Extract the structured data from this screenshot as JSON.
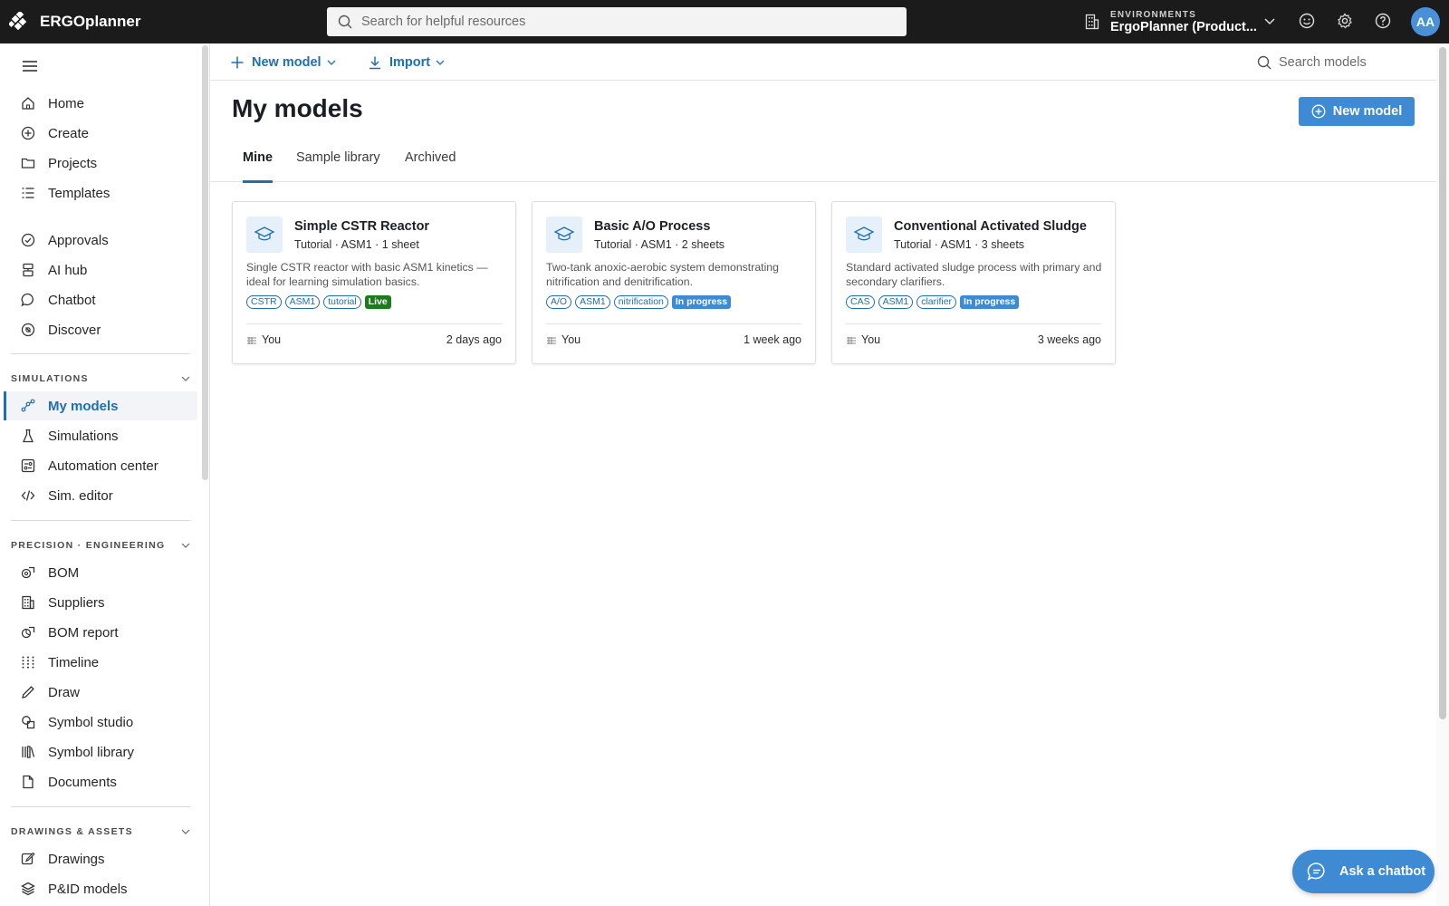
{
  "app": {
    "title": "ERGOplanner"
  },
  "search": {
    "placeholder": "Search for helpful resources"
  },
  "environment": {
    "label": "ENVIRONMENTS",
    "value": "ErgoPlanner (Product..."
  },
  "user": {
    "initials": "AA"
  },
  "sidebar": {
    "items": [
      {
        "label": "Home",
        "icon": "home-icon"
      },
      {
        "label": "Create",
        "icon": "plus-circle-icon"
      },
      {
        "label": "Projects",
        "icon": "folder-icon"
      },
      {
        "label": "Templates",
        "icon": "list-icon"
      },
      {
        "label": "Approvals",
        "icon": "check-circle-icon"
      },
      {
        "label": "AI hub",
        "icon": "ai-hub-icon"
      },
      {
        "label": "Chatbot",
        "icon": "chat-icon"
      },
      {
        "label": "Discover",
        "icon": "compass-icon"
      }
    ],
    "sections": [
      {
        "title": "SIMULATIONS",
        "items": [
          {
            "label": "My models",
            "icon": "model-graph-icon",
            "active": true
          },
          {
            "label": "Simulations",
            "icon": "flask-icon"
          },
          {
            "label": "Automation center",
            "icon": "automation-icon"
          },
          {
            "label": "Sim. editor",
            "icon": "code-icon"
          }
        ]
      },
      {
        "title": "PRECISION · ENGINEERING",
        "items": [
          {
            "label": "BOM",
            "icon": "bom-icon"
          },
          {
            "label": "Suppliers",
            "icon": "building-icon"
          },
          {
            "label": "BOM report",
            "icon": "report-icon"
          },
          {
            "label": "Timeline",
            "icon": "grid-dots-icon"
          },
          {
            "label": "Draw",
            "icon": "pencil-icon"
          },
          {
            "label": "Symbol studio",
            "icon": "shapes-icon"
          },
          {
            "label": "Symbol library",
            "icon": "library-icon"
          },
          {
            "label": "Documents",
            "icon": "document-icon"
          }
        ]
      },
      {
        "title": "DRAWINGS & ASSETS",
        "items": [
          {
            "label": "Drawings",
            "icon": "drawing-icon"
          },
          {
            "label": "P&ID models",
            "icon": "layers-icon"
          }
        ]
      }
    ]
  },
  "toolbar": {
    "new_model": "New model",
    "import": "Import",
    "search_placeholder": "Search models"
  },
  "main": {
    "title": "My models",
    "new_model_button": "New model",
    "tabs": [
      {
        "label": "Mine",
        "active": true
      },
      {
        "label": "Sample library"
      },
      {
        "label": "Archived"
      }
    ],
    "cards": [
      {
        "title": "Simple CSTR Reactor",
        "meta": "Tutorial · ASM1 · 1 sheet",
        "description": "Single CSTR reactor with basic ASM1 kinetics — ideal for learning simulation basics.",
        "tags": [
          "CSTR",
          "ASM1",
          "tutorial"
        ],
        "status": "Live",
        "owner": "You",
        "updated": "2 days ago"
      },
      {
        "title": "Basic A/O Process",
        "meta": "Tutorial · ASM1 · 2 sheets",
        "description": "Two-tank anoxic-aerobic system demonstrating nitrification and denitrification.",
        "tags": [
          "A/O",
          "ASM1",
          "nitrification"
        ],
        "status": "In progress",
        "owner": "You",
        "updated": "1 week ago"
      },
      {
        "title": "Conventional Activated Sludge",
        "meta": "Tutorial · ASM1 · 3 sheets",
        "description": "Standard activated sludge process with primary and secondary clarifiers.",
        "tags": [
          "CAS",
          "ASM1",
          "clarifier"
        ],
        "status": "In progress",
        "owner": "You",
        "updated": "3 weeks ago"
      }
    ]
  },
  "chatbot": {
    "label": "Ask a chatbot"
  },
  "colors": {
    "accent": "#1f6fb2",
    "primary_button": "#3f8bd3",
    "live": "#1f7a1f",
    "topbar": "#1b1b1b"
  }
}
